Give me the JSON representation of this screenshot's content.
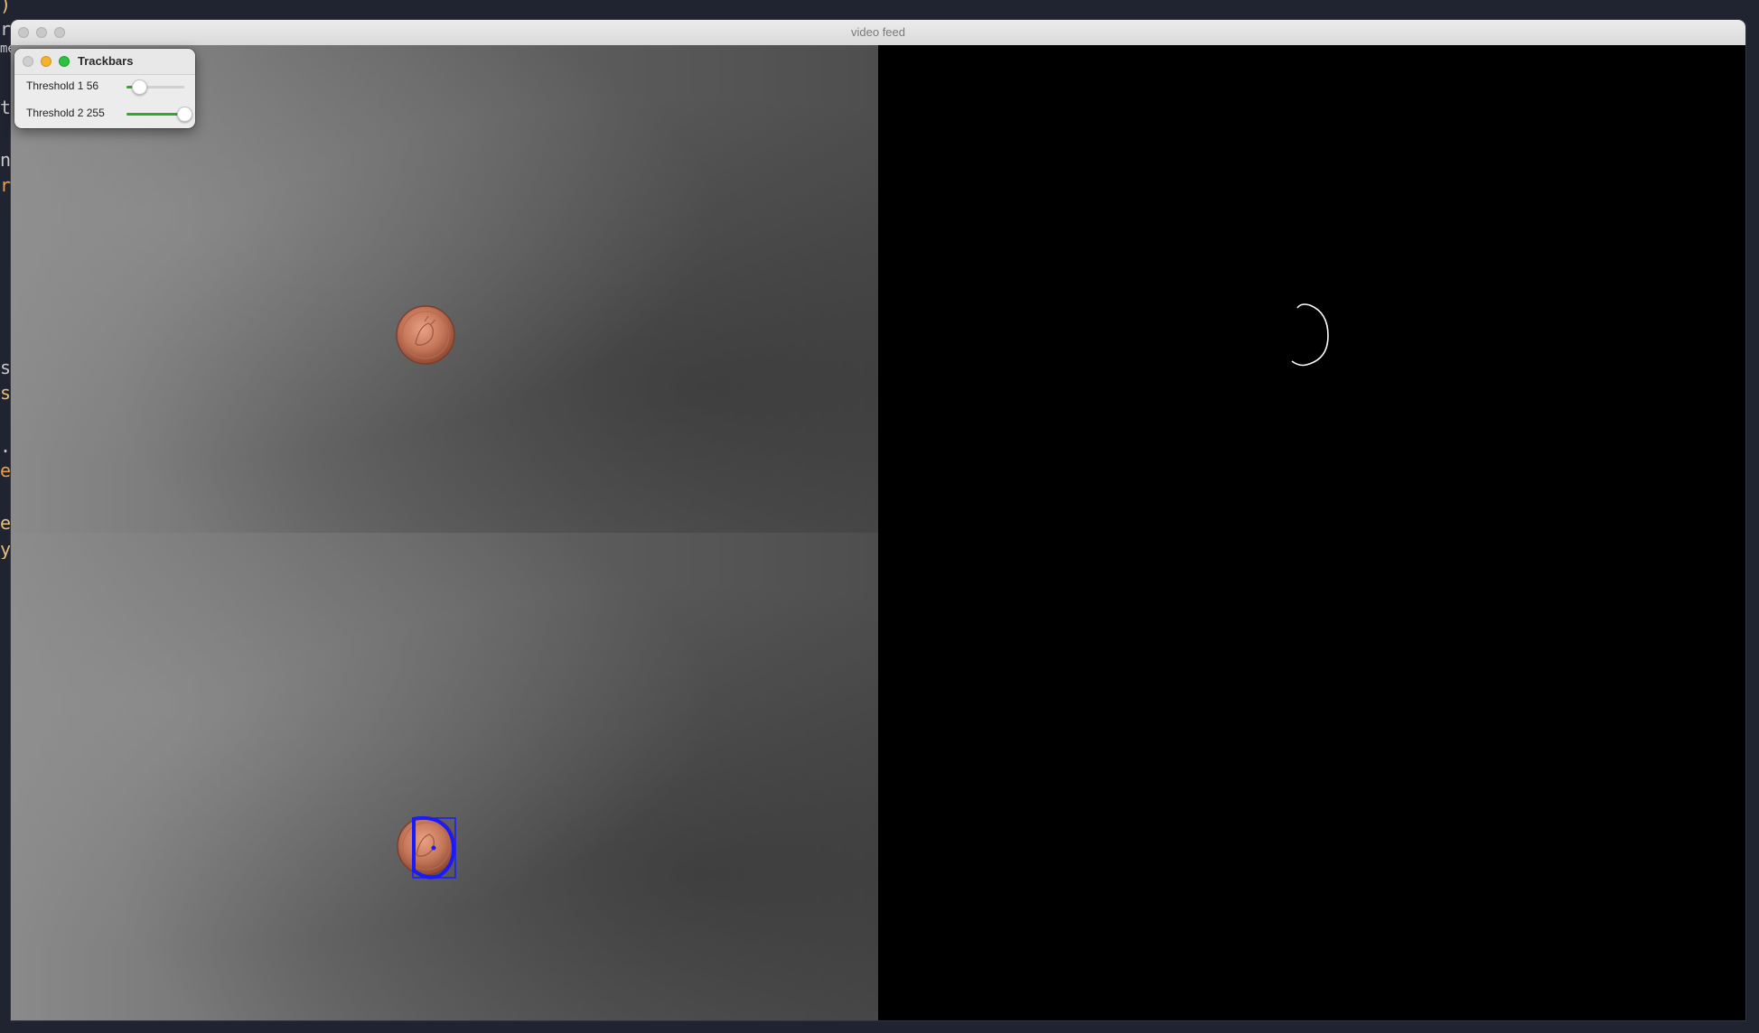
{
  "main_window": {
    "title": "video feed"
  },
  "trackbars_window": {
    "title": "Trackbars",
    "trackbars": [
      {
        "label": "Threshold 1",
        "value": "56",
        "fraction": 0.22
      },
      {
        "label": "Threshold 2",
        "value": "255",
        "fraction": 1.0
      }
    ]
  },
  "background_code": [
    {
      "text": "):",
      "color": "#e5c07b"
    },
    {
      "text": "ra",
      "color": "#c8c8c8"
    },
    {
      "text": "me",
      "color": "#c8c8c8"
    },
    {
      "text": "t(",
      "color": "#c8c8c8"
    },
    {
      "text": "nc",
      "color": "#c8c8c8"
    },
    {
      "text": "r",
      "color": "#e8a04a"
    },
    {
      "text": "st",
      "color": "#c8c8c8"
    },
    {
      "text": "sh",
      "color": "#e5c07b"
    },
    {
      "text": ".w",
      "color": "#c8c8c8"
    },
    {
      "text": "ea",
      "color": "#e8a04a"
    },
    {
      "text": "e",
      "color": "#e5c07b"
    },
    {
      "text": "y(",
      "color": "#e5c07b"
    }
  ],
  "colors": {
    "contour": "#1a1aff",
    "edge_trace": "#ffffff",
    "slider_fill": "#34a52e"
  }
}
